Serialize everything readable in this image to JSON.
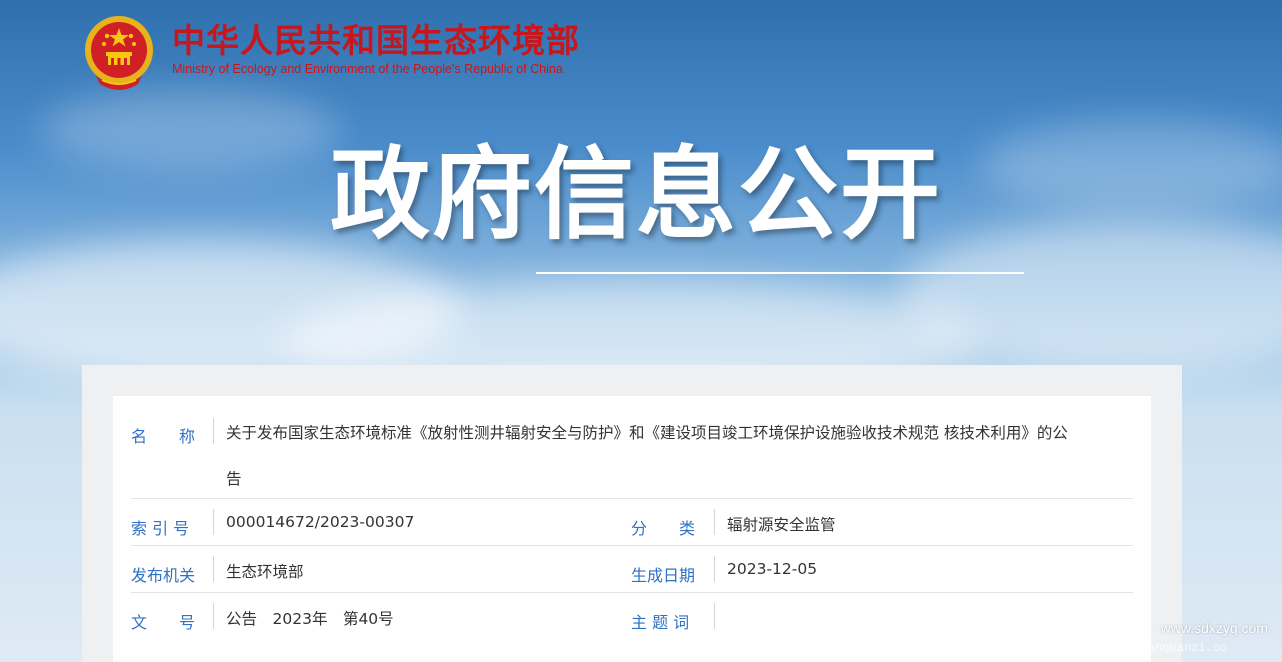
{
  "header": {
    "org_name_cn": "中华人民共和国生态环境部",
    "org_name_en": "Ministry of Ecology and Environment of the People's Republic of China"
  },
  "banner": {
    "title": "政府信息公开"
  },
  "info": {
    "name_label": "名　　称",
    "name_value_line1": "关于发布国家生态环境标准《放射性测井辐射安全与防护》和《建设项目竣工环境保护设施验收技术规范 核技术利用》的公",
    "name_value_line2": "告",
    "index_label": "索 引 号",
    "index_value": "000014672/2023-00307",
    "category_label": "分　　类",
    "category_value": "辐射源安全监管",
    "issuer_label": "发布机关",
    "issuer_value": "生态环境部",
    "date_label": "生成日期",
    "date_value": "2023-12-05",
    "docno_label": "文　　号",
    "docno_value": "公告　2023年　第40号",
    "subject_label": "主 题 词",
    "subject_value": ""
  },
  "watermark": {
    "line1": "www.sdxzyq.com",
    "line2": "fengbanquanzi.co"
  },
  "colors": {
    "brand_red": "#c8161d",
    "label_blue": "#2f72c4",
    "text": "#333333"
  }
}
